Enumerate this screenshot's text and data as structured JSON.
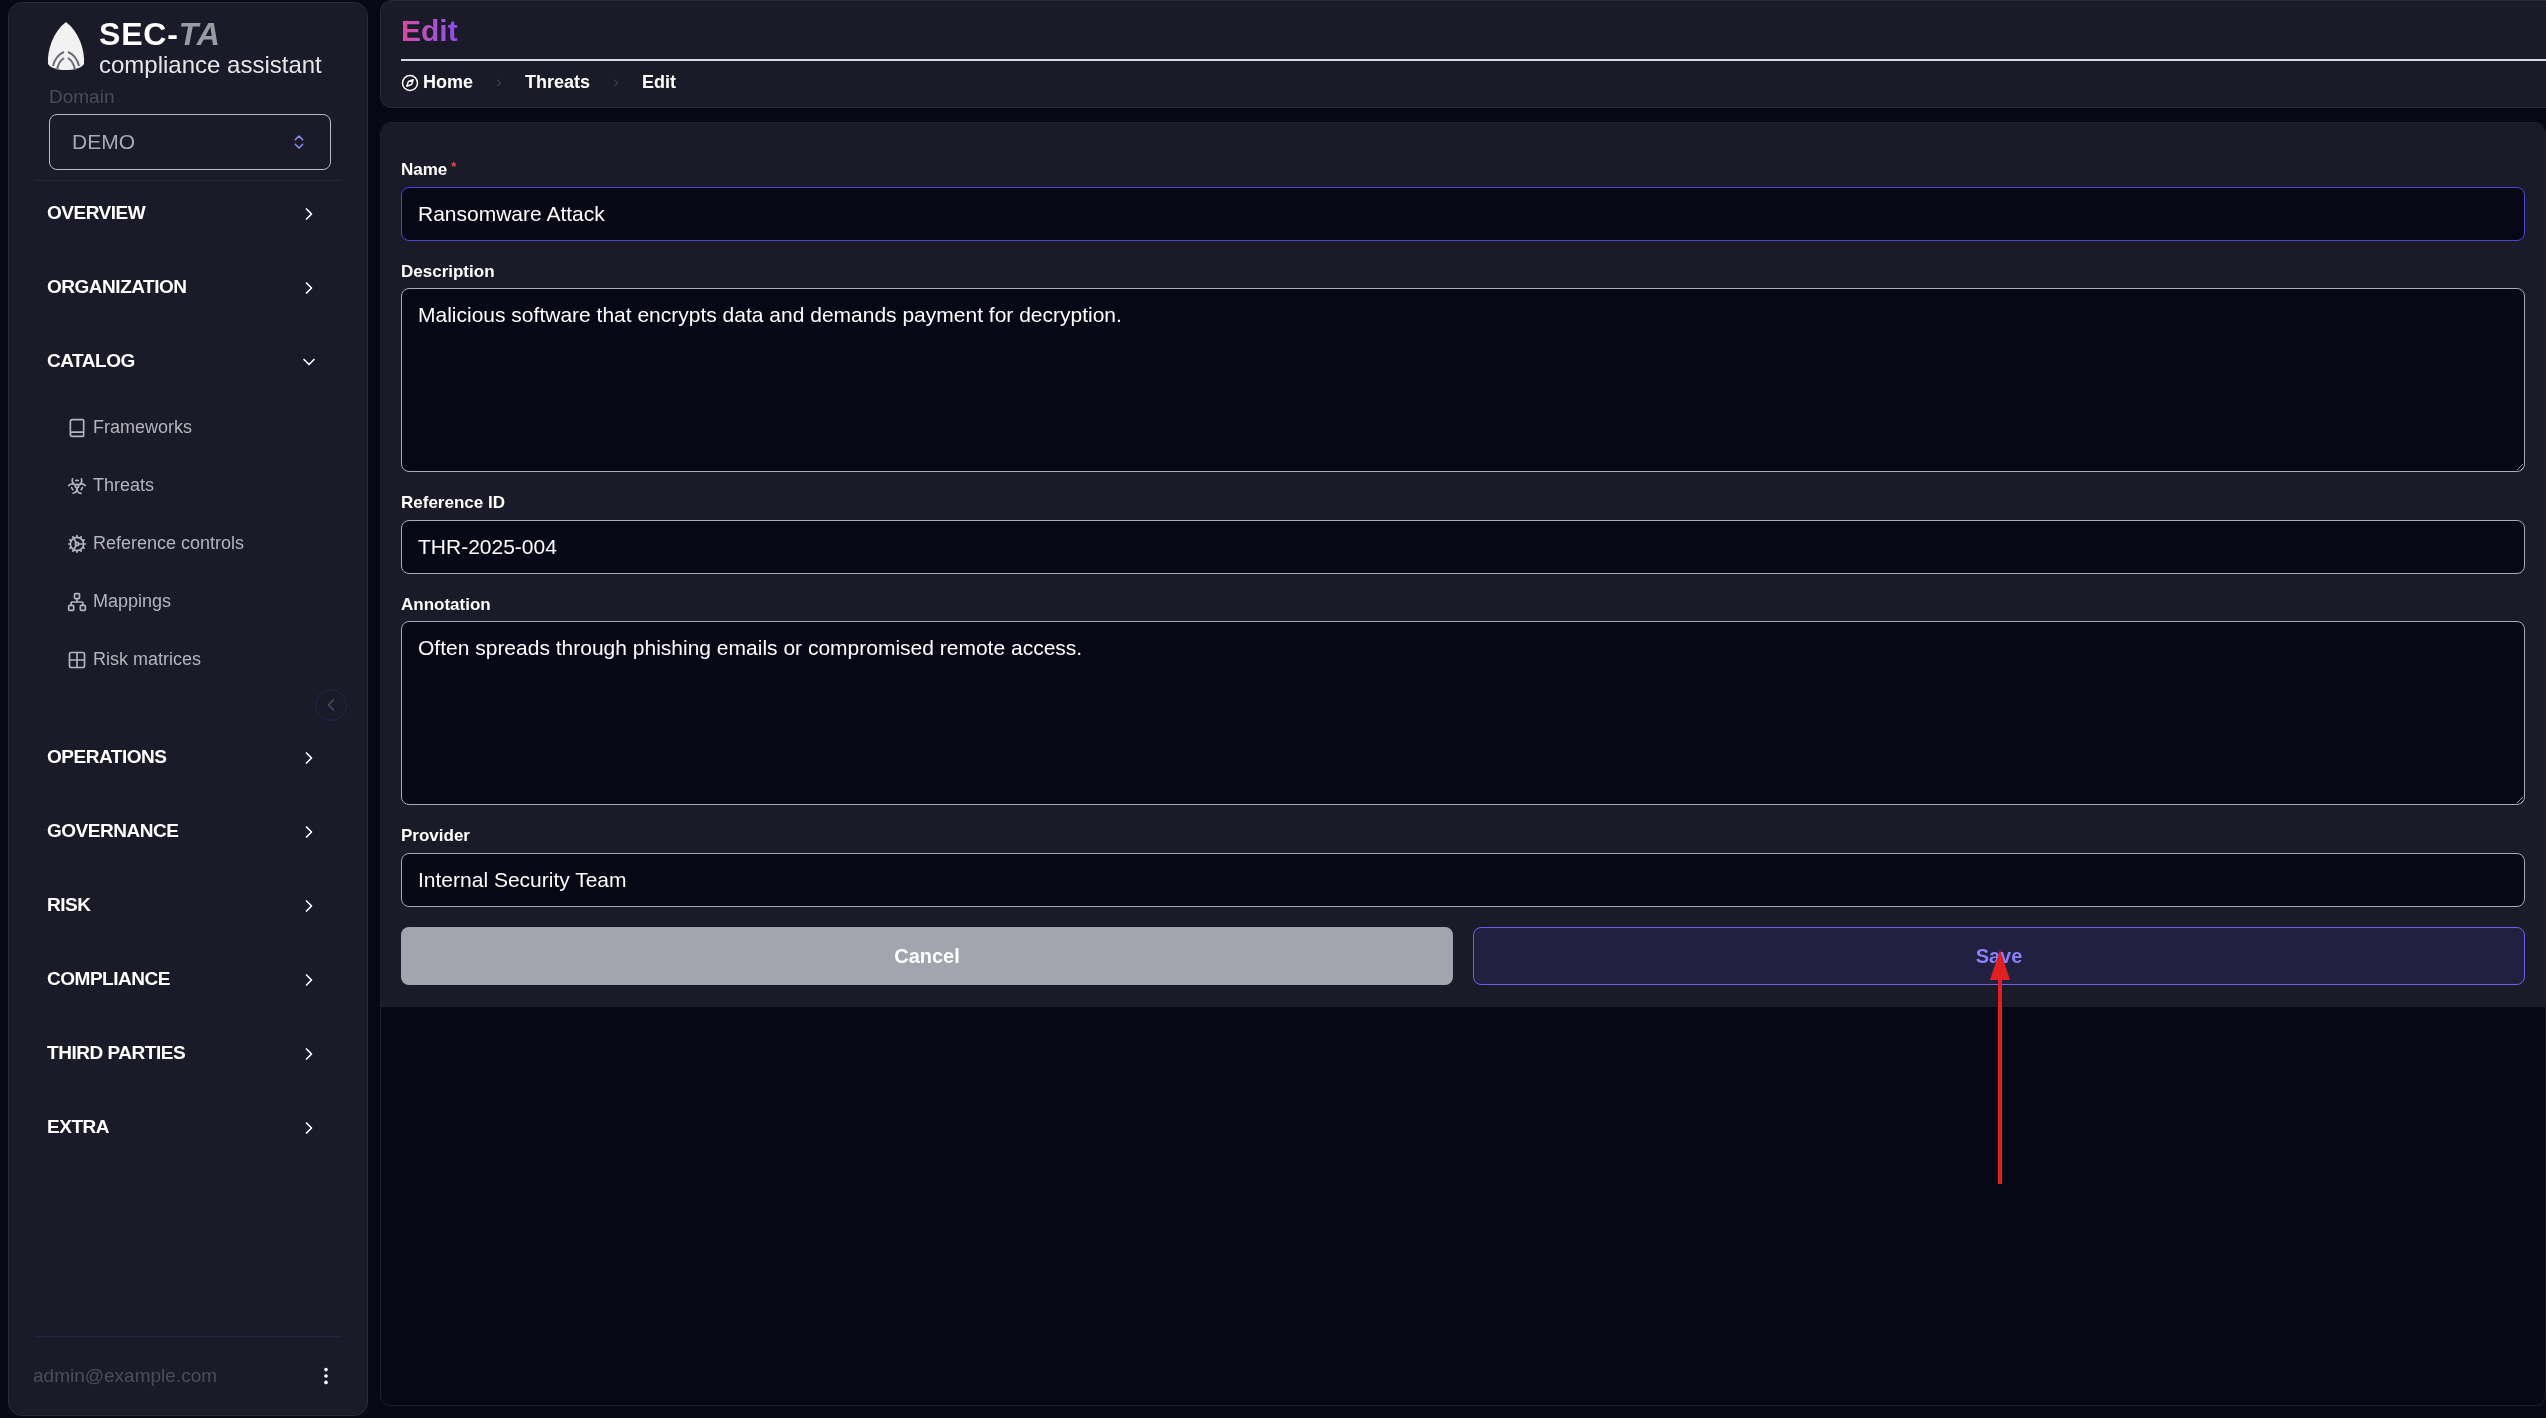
{
  "sidebar": {
    "brand": {
      "title": "SEC-",
      "title_accent": "TA",
      "subtitle": "compliance assistant"
    },
    "domain": {
      "label": "Domain",
      "value": "DEMO"
    },
    "nav": [
      {
        "label": "OVERVIEW",
        "expanded": false
      },
      {
        "label": "ORGANIZATION",
        "expanded": false
      },
      {
        "label": "CATALOG",
        "expanded": true,
        "children": [
          {
            "label": "Frameworks"
          },
          {
            "label": "Threats"
          },
          {
            "label": "Reference controls"
          },
          {
            "label": "Mappings"
          },
          {
            "label": "Risk matrices"
          }
        ]
      },
      {
        "label": "OPERATIONS",
        "expanded": false
      },
      {
        "label": "GOVERNANCE",
        "expanded": false
      },
      {
        "label": "RISK",
        "expanded": false
      },
      {
        "label": "COMPLIANCE",
        "expanded": false
      },
      {
        "label": "THIRD PARTIES",
        "expanded": false
      },
      {
        "label": "EXTRA",
        "expanded": false
      }
    ],
    "user": "admin@example.com"
  },
  "header": {
    "title": "Edit",
    "breadcrumb": [
      "Home",
      "Threats",
      "Edit"
    ]
  },
  "form": {
    "fields": [
      {
        "label": "Name",
        "required_mark": "*",
        "kind": "input",
        "value": "Ransomware Attack",
        "focused": true
      },
      {
        "label": "Description",
        "kind": "textarea",
        "value": "Malicious software that encrypts data and demands payment for decryption.",
        "focused": false
      },
      {
        "label": "Reference ID",
        "kind": "input",
        "value": "THR-2025-004",
        "focused": false
      },
      {
        "label": "Annotation",
        "kind": "textarea",
        "value": "Often spreads through phishing emails or compromised remote access.",
        "focused": false
      },
      {
        "label": "Provider",
        "kind": "input",
        "value": "Internal Security Team",
        "focused": false
      }
    ],
    "buttons": [
      {
        "label": "Cancel",
        "kind": "secondary"
      },
      {
        "label": "Save",
        "kind": "primary"
      }
    ]
  }
}
